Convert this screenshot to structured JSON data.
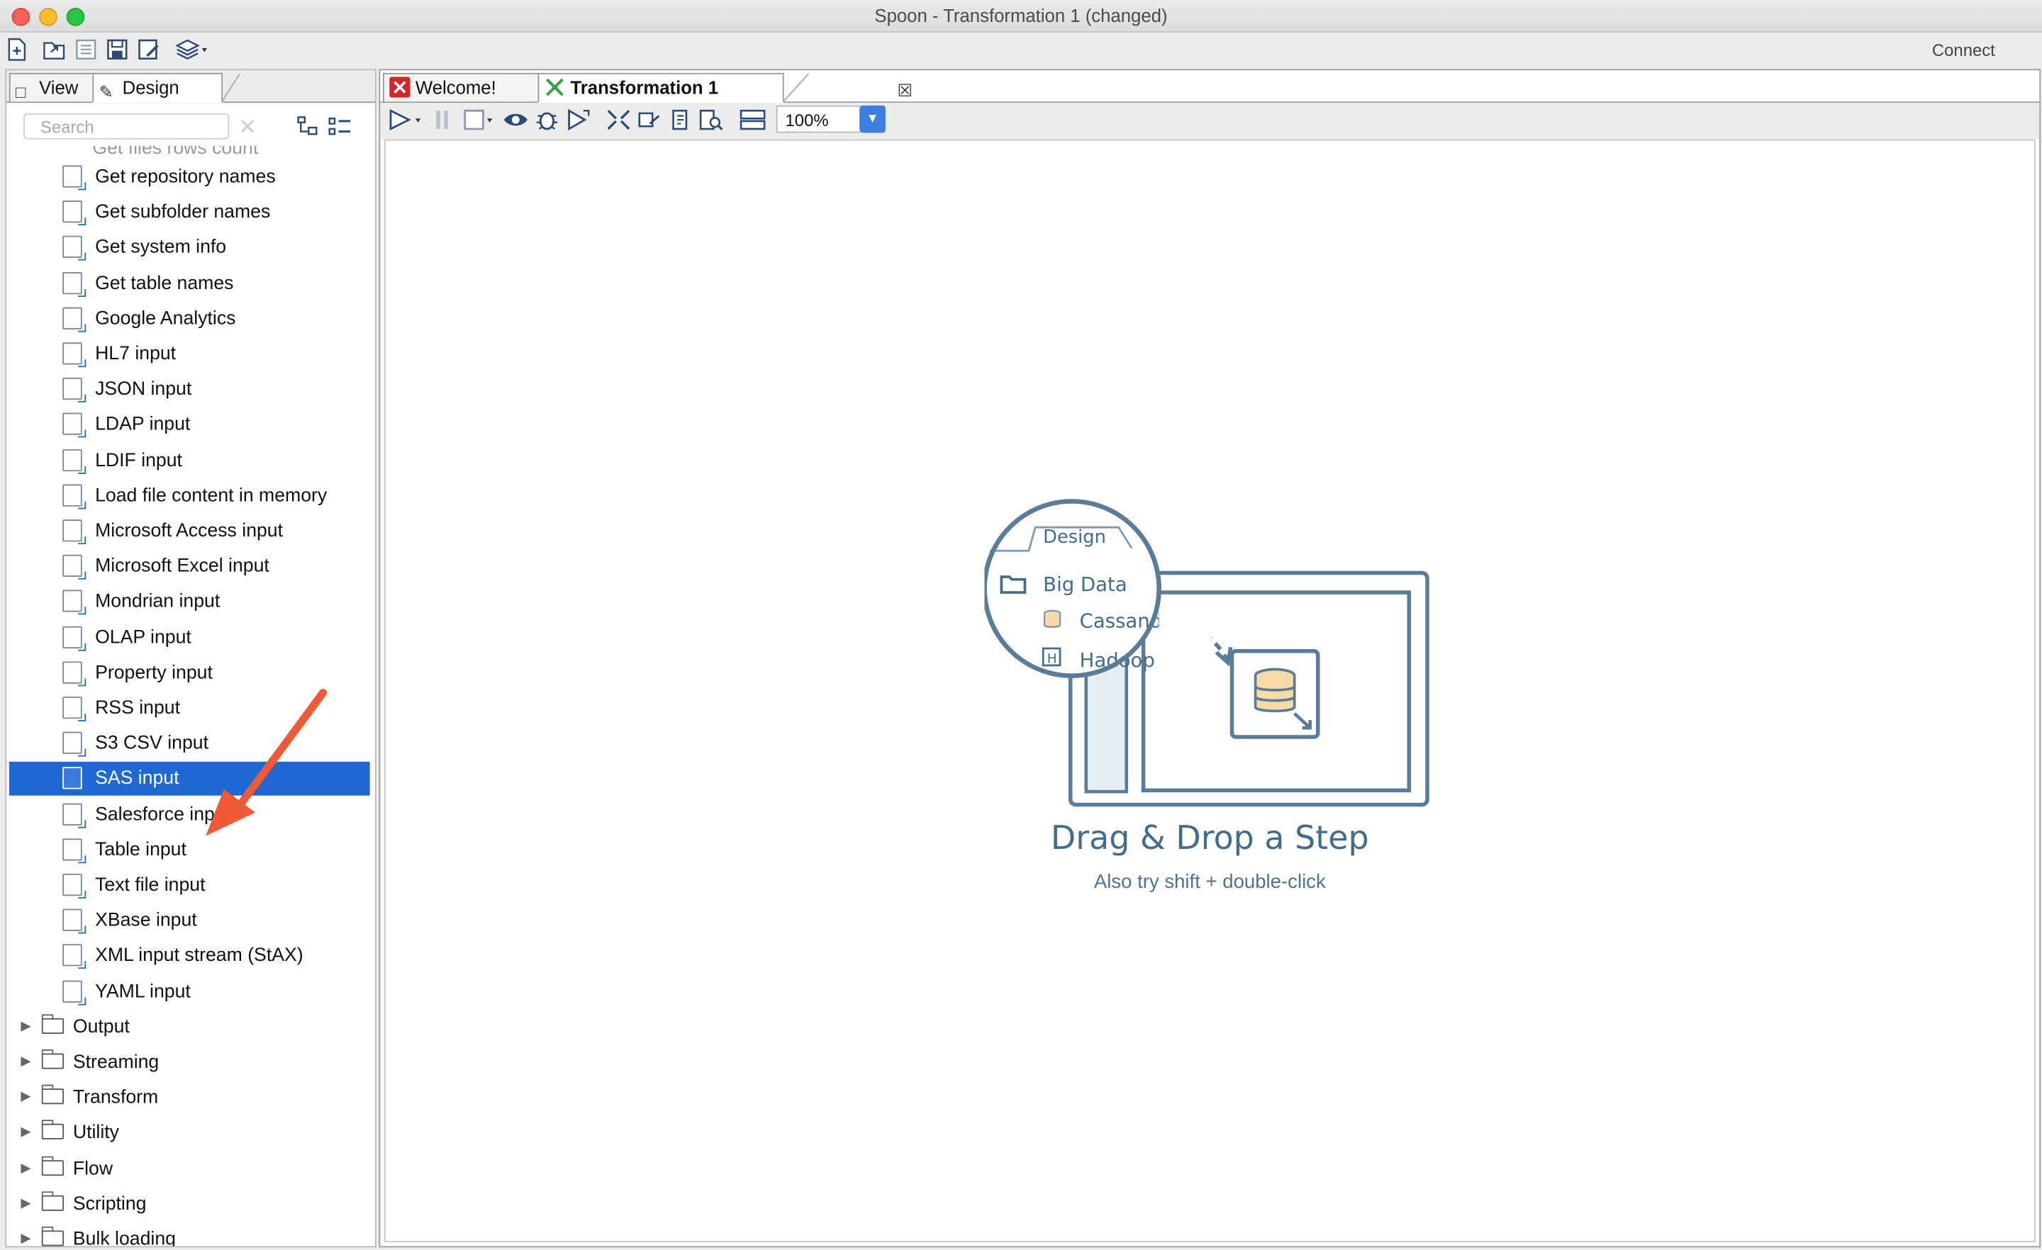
{
  "window": {
    "title": "Spoon - Transformation 1 (changed)"
  },
  "toolbar": {
    "connect_label": "Connect"
  },
  "left_panel": {
    "tabs": [
      {
        "label": "View"
      },
      {
        "label": "Design"
      }
    ],
    "search_placeholder": "Search",
    "cut_item": "Get files rows count",
    "steps": [
      {
        "label": "Get repository names",
        "icon": "repository-icon"
      },
      {
        "label": "Get subfolder names",
        "icon": "subfolder-icon"
      },
      {
        "label": "Get system info",
        "icon": "system-info-icon"
      },
      {
        "label": "Get table names",
        "icon": "table-names-icon"
      },
      {
        "label": "Google Analytics",
        "icon": "google-analytics-icon"
      },
      {
        "label": "HL7 input",
        "icon": "hl7-icon"
      },
      {
        "label": "JSON input",
        "icon": "json-icon"
      },
      {
        "label": "LDAP input",
        "icon": "ldap-icon"
      },
      {
        "label": "LDIF input",
        "icon": "ldif-icon"
      },
      {
        "label": "Load file content in memory",
        "icon": "file-content-icon"
      },
      {
        "label": "Microsoft Access input",
        "icon": "access-icon"
      },
      {
        "label": "Microsoft Excel input",
        "icon": "excel-icon"
      },
      {
        "label": "Mondrian input",
        "icon": "mondrian-icon"
      },
      {
        "label": "OLAP input",
        "icon": "olap-icon"
      },
      {
        "label": "Property input",
        "icon": "property-icon"
      },
      {
        "label": "RSS input",
        "icon": "rss-icon"
      },
      {
        "label": "S3 CSV input",
        "icon": "s3-csv-icon"
      },
      {
        "label": "SAS input",
        "icon": "sas-icon",
        "selected": true
      },
      {
        "label": "Salesforce input",
        "icon": "salesforce-icon"
      },
      {
        "label": "Table input",
        "icon": "table-input-icon"
      },
      {
        "label": "Text file input",
        "icon": "text-file-icon"
      },
      {
        "label": "XBase input",
        "icon": "xbase-icon"
      },
      {
        "label": "XML input stream (StAX)",
        "icon": "xml-stax-icon"
      },
      {
        "label": "YAML input",
        "icon": "yaml-icon"
      }
    ],
    "folders": [
      {
        "label": "Output"
      },
      {
        "label": "Streaming"
      },
      {
        "label": "Transform"
      },
      {
        "label": "Utility"
      },
      {
        "label": "Flow"
      },
      {
        "label": "Scripting"
      },
      {
        "label": "Bulk loading"
      }
    ]
  },
  "editor": {
    "tabs": [
      {
        "label": "Welcome!"
      },
      {
        "label": "Transformation 1"
      }
    ],
    "zoom": "100%",
    "illustration": {
      "design_tab": "Design",
      "folder": "Big Data",
      "item1": "Cassandra",
      "item2": "Hadoop"
    },
    "drag_title": "Drag & Drop a Step",
    "drag_subtitle": "Also try shift + double-click"
  },
  "colors": {
    "selection": "#2167d4",
    "arrow": "#ee5a35",
    "illustration": "#456b8a"
  }
}
